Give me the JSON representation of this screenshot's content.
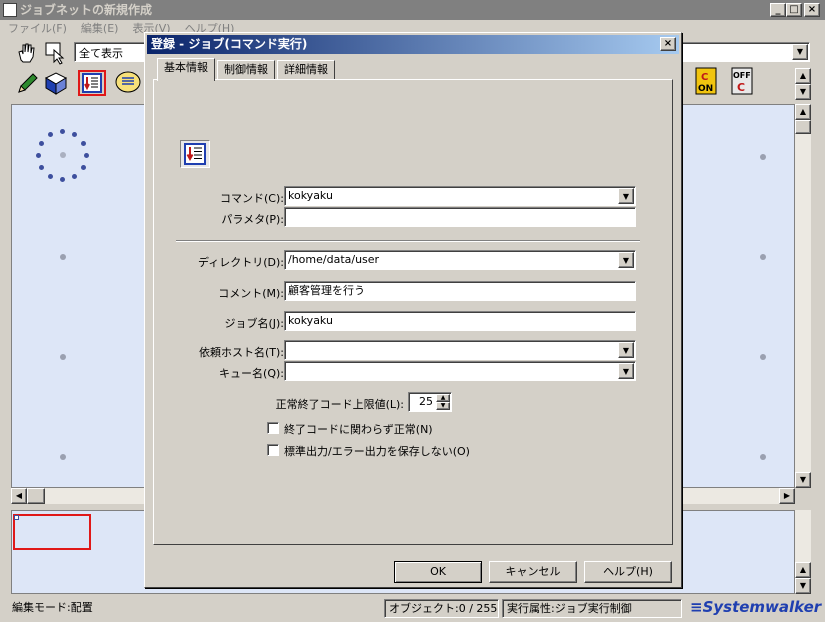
{
  "main_window": {
    "title": "ジョブネットの新規作成",
    "menu": [
      "ファイル(F)",
      "編集(E)",
      "表示(V)",
      "ヘルプ(H)"
    ],
    "view_combo": "全て表示",
    "buttons": {
      "minimize": "_",
      "maximize": "□",
      "close": "×"
    },
    "toolbar_icons": [
      "hand-tool",
      "select-tool",
      "pencil-tool",
      "book-tool",
      "command-job-tool",
      "message-job-tool",
      "c-on-tool",
      "off-c-tool"
    ],
    "c_on_text": "C\nON",
    "off_c_text": "OFF\nC"
  },
  "status": {
    "mode": "編集モード:配置",
    "objects": "オブジェクト:0 / 255",
    "exec_attr": "実行属性:ジョブ実行制御",
    "brand": "Systemwalker"
  },
  "dialog": {
    "title": "登録 - ジョブ(コマンド実行)",
    "close": "×",
    "tabs": [
      "基本情報",
      "制御情報",
      "詳細情報"
    ],
    "fields": {
      "command": {
        "label": "コマンド(C):",
        "value": "kokyaku"
      },
      "parameter": {
        "label": "パラメタ(P):",
        "value": ""
      },
      "directory": {
        "label": "ディレクトリ(D):",
        "value": "/home/data/user"
      },
      "comment": {
        "label": "コメント(M):",
        "value": "顧客管理を行う"
      },
      "job_name": {
        "label": "ジョブ名(J):",
        "value": "kokyaku"
      },
      "host_name": {
        "label": "依頼ホスト名(T):",
        "value": ""
      },
      "queue_name": {
        "label": "キュー名(Q):",
        "value": ""
      },
      "exit_code_limit": {
        "label": "正常終了コード上限値(L):",
        "value": "25"
      }
    },
    "checkboxes": {
      "ignore_exit_code": {
        "label": "終了コードに関わらず正常(N)",
        "checked": false
      },
      "no_save_output": {
        "label": "標準出力/エラー出力を保存しない(O)",
        "checked": false
      }
    },
    "buttons": {
      "ok": "OK",
      "cancel": "キャンセル",
      "help": "ヘルプ(H)"
    }
  }
}
